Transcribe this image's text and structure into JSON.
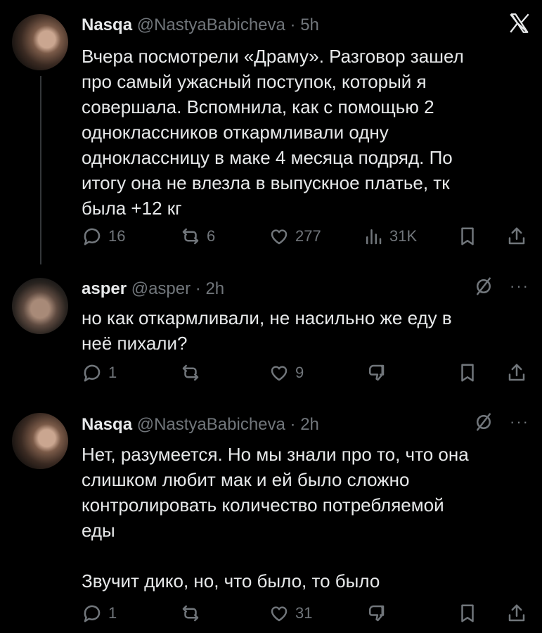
{
  "tweets": [
    {
      "name": "Nasqa",
      "handle": "@NastyaBabicheva",
      "time": "· 5h",
      "text": "Вчера посмотрели «Драму». Разговор зашел\nпро самый ужасный поступок, который я\nсовершала. Вспомнила, как с помощью 2\nодноклассников откармливали одну\nодноклассницу в маке 4 месяца подряд. По\nитогу она не влезла в выпускное платье, тк\nбыла +12 кг",
      "replies": "16",
      "retweets": "6",
      "likes": "277",
      "views": "31K"
    },
    {
      "name": "asper",
      "handle": "@asper",
      "time": "· 2h",
      "text": "но как откармливали, не насильно же еду в\nнеё пихали?",
      "replies": "1",
      "retweets": "",
      "likes": "9"
    },
    {
      "name": "Nasqa",
      "handle": "@NastyaBabicheva",
      "time": "· 2h",
      "text": "Нет, разумеется. Но мы знали про то, что она\nслишком любит мак и ей было сложно\nконтролировать количество потребляемой\nеды\n\nЗвучит дико, но, что было, то было",
      "replies": "1",
      "retweets": "",
      "likes": "31"
    }
  ],
  "more_label": "···",
  "icons": [
    "x-logo-icon",
    "reply-icon",
    "retweet-icon",
    "like-icon",
    "views-icon",
    "bookmark-icon",
    "share-icon",
    "grok-icon",
    "more-icon",
    "dislike-icon"
  ]
}
